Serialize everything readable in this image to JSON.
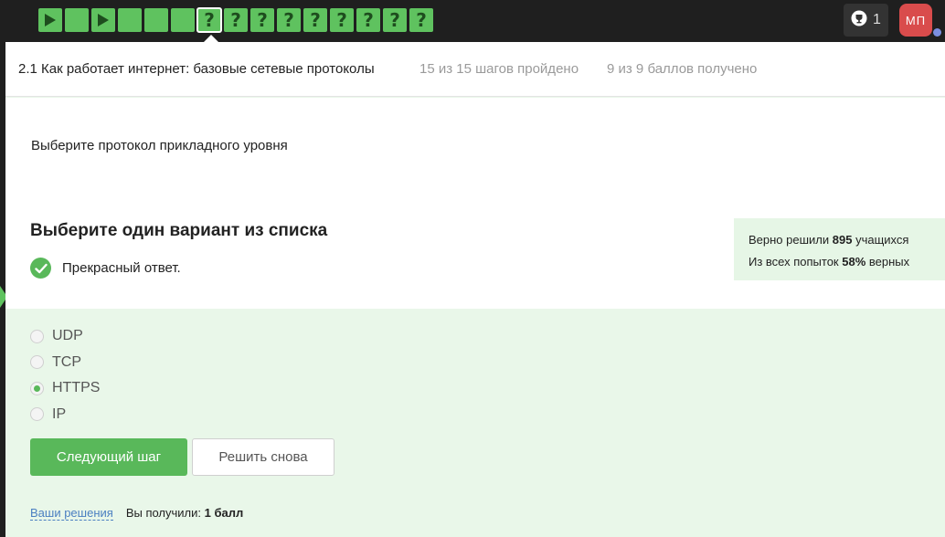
{
  "steps": [
    {
      "type": "play",
      "active": false
    },
    {
      "type": "text",
      "active": false
    },
    {
      "type": "play",
      "active": false
    },
    {
      "type": "text",
      "active": false
    },
    {
      "type": "text",
      "active": false
    },
    {
      "type": "text",
      "active": false
    },
    {
      "type": "quiz",
      "active": true
    },
    {
      "type": "quiz",
      "active": false
    },
    {
      "type": "quiz",
      "active": false
    },
    {
      "type": "quiz",
      "active": false
    },
    {
      "type": "quiz",
      "active": false
    },
    {
      "type": "quiz",
      "active": false
    },
    {
      "type": "quiz",
      "active": false
    },
    {
      "type": "quiz",
      "active": false
    },
    {
      "type": "quiz",
      "active": false
    }
  ],
  "quiz_symbol": "?",
  "topbar": {
    "trophy_count": "1",
    "avatar_initials": "МП"
  },
  "lesson": {
    "title": "2.1 Как работает интернет: базовые сетевые протоколы",
    "progress": "15 из 15 шагов пройдено",
    "score": "9 из 9 баллов  получено"
  },
  "question": "Выберите протокол прикладного уровня",
  "heading": "Выберите один вариант из списка",
  "feedback": "Прекрасный ответ.",
  "stats": {
    "solved_prefix": "Верно решили ",
    "solved_count": "895",
    "solved_suffix": " учащихся",
    "attempts_prefix": "Из всех попыток ",
    "attempts_percent": "58%",
    "attempts_suffix": " верных"
  },
  "options": [
    {
      "label": "UDP",
      "checked": false
    },
    {
      "label": "TCP",
      "checked": false
    },
    {
      "label": "HTTPS",
      "checked": true
    },
    {
      "label": "IP",
      "checked": false
    }
  ],
  "buttons": {
    "next": "Следующий шаг",
    "retry": "Решить снова"
  },
  "footer": {
    "solutions_link": "Ваши решения",
    "received_label": "Вы получили: ",
    "received_value": "1 балл"
  },
  "colors": {
    "accent": "#59b85a",
    "step": "#5fc25f",
    "topbar": "#1f1f1f",
    "avatar": "#d94c4c"
  }
}
